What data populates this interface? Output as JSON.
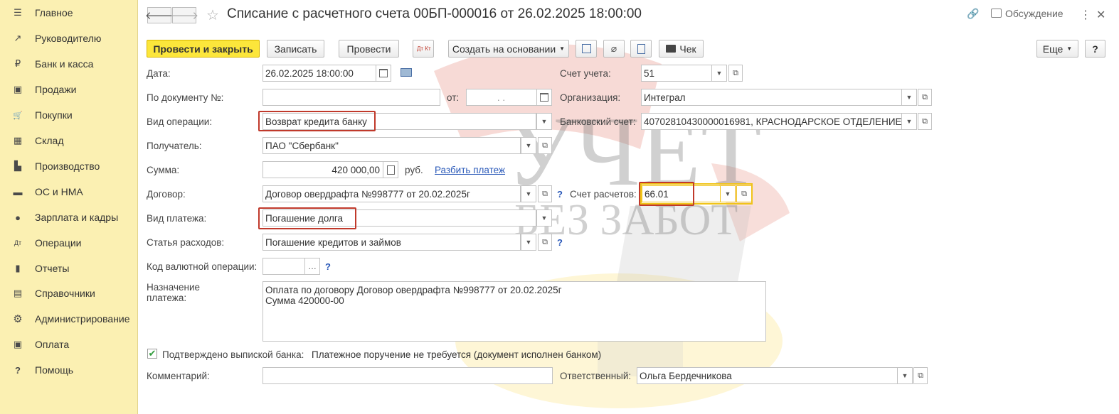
{
  "sidebar": {
    "items": [
      {
        "label": "Главное",
        "icon": "menu-icon",
        "glyph": "☰"
      },
      {
        "label": "Руководителю",
        "icon": "trend-icon",
        "glyph": "↗"
      },
      {
        "label": "Банк и касса",
        "icon": "ruble-coin-icon",
        "glyph": "₽"
      },
      {
        "label": "Продажи",
        "icon": "shopping-bag-icon",
        "glyph": "▣"
      },
      {
        "label": "Покупки",
        "icon": "cart-icon",
        "glyph": "🛒"
      },
      {
        "label": "Склад",
        "icon": "warehouse-icon",
        "glyph": "▦"
      },
      {
        "label": "Производство",
        "icon": "factory-icon",
        "glyph": "▙"
      },
      {
        "label": "ОС и НМА",
        "icon": "truck-icon",
        "glyph": "▬"
      },
      {
        "label": "Зарплата и кадры",
        "icon": "person-icon",
        "glyph": "●"
      },
      {
        "label": "Операции",
        "icon": "dt-kt-icon",
        "glyph": "Дт"
      },
      {
        "label": "Отчеты",
        "icon": "bar-chart-icon",
        "glyph": "▮"
      },
      {
        "label": "Справочники",
        "icon": "books-icon",
        "glyph": "▤"
      },
      {
        "label": "Администрирование",
        "icon": "gear-icon",
        "glyph": "⚙"
      },
      {
        "label": "Оплата",
        "icon": "payment-icon",
        "glyph": "▣"
      },
      {
        "label": "Помощь",
        "icon": "help-icon",
        "glyph": "?"
      }
    ]
  },
  "header": {
    "back_glyph": "🡐",
    "forward_glyph": "🡒",
    "star_glyph": "☆",
    "title": "Списание с расчетного счета 00БП-000016 от 26.02.2025 18:00:00",
    "link_glyph": "🔗",
    "discussion_label": "Обсуждение",
    "more_glyph": "⋮",
    "close_glyph": "✕"
  },
  "toolbar": {
    "post_close": "Провести и закрыть",
    "save": "Записать",
    "post": "Провести",
    "dtkt": "Дт Кт",
    "create_based": "Создать на основании",
    "check": "Чек",
    "more": "Еще",
    "help": "?"
  },
  "form": {
    "date_label": "Дата:",
    "date_value": "26.02.2025 18:00:00",
    "doc_label": "По документу №:",
    "doc_value": "",
    "from_label": "от:",
    "from_value": ". .",
    "op_type_label": "Вид операции:",
    "op_type_value": "Возврат кредита банку",
    "recipient_label": "Получатель:",
    "recipient_value": "ПАО \"Сбербанк\"",
    "amount_label": "Сумма:",
    "amount_value": "420 000,00",
    "currency": "руб.",
    "split_link": "Разбить платеж",
    "contract_label": "Договор:",
    "contract_value": "Договор овердрафта №998777 от 20.02.2025г",
    "pay_type_label": "Вид платежа:",
    "pay_type_value": "Погашение долга",
    "expense_label": "Статья расходов:",
    "expense_value": "Погашение кредитов и займов",
    "currency_op_label": "Код валютной операции:",
    "currency_op_value": "",
    "purpose_label_1": "Назначение",
    "purpose_label_2": "платежа:",
    "purpose_line_1": "Оплата по договору Договор овердрафта №998777 от 20.02.2025г",
    "purpose_line_2": "Сумма 420000-00",
    "confirmed_label": "Подтверждено выпиской банка:",
    "confirmed_note": "Платежное поручение не требуется (документ исполнен банком)",
    "comment_label": "Комментарий:",
    "comment_value": "",
    "account_label": "Счет учета:",
    "account_value": "51",
    "org_label": "Организация:",
    "org_value": "Интеграл",
    "bank_account_label": "Банковский счет:",
    "bank_account_value": "40702810430000016981, КРАСНОДАРСКОЕ ОТДЕЛЕНИЕ",
    "settle_label": "Счет расчетов:",
    "settle_value": "66.01",
    "responsible_label": "Ответственный:",
    "responsible_value": "Ольга Бердечникова",
    "help_q": "?"
  },
  "watermark": {
    "line1": "УЧЕТ",
    "line2": "БЕЗ ЗАБОТ"
  },
  "colors": {
    "sidebar_bg": "#fbf0b2",
    "primary_button": "#fce63b",
    "highlight_red": "#c0392b",
    "highlight_yellow": "#f0c419",
    "link_blue": "#2a59b9"
  }
}
